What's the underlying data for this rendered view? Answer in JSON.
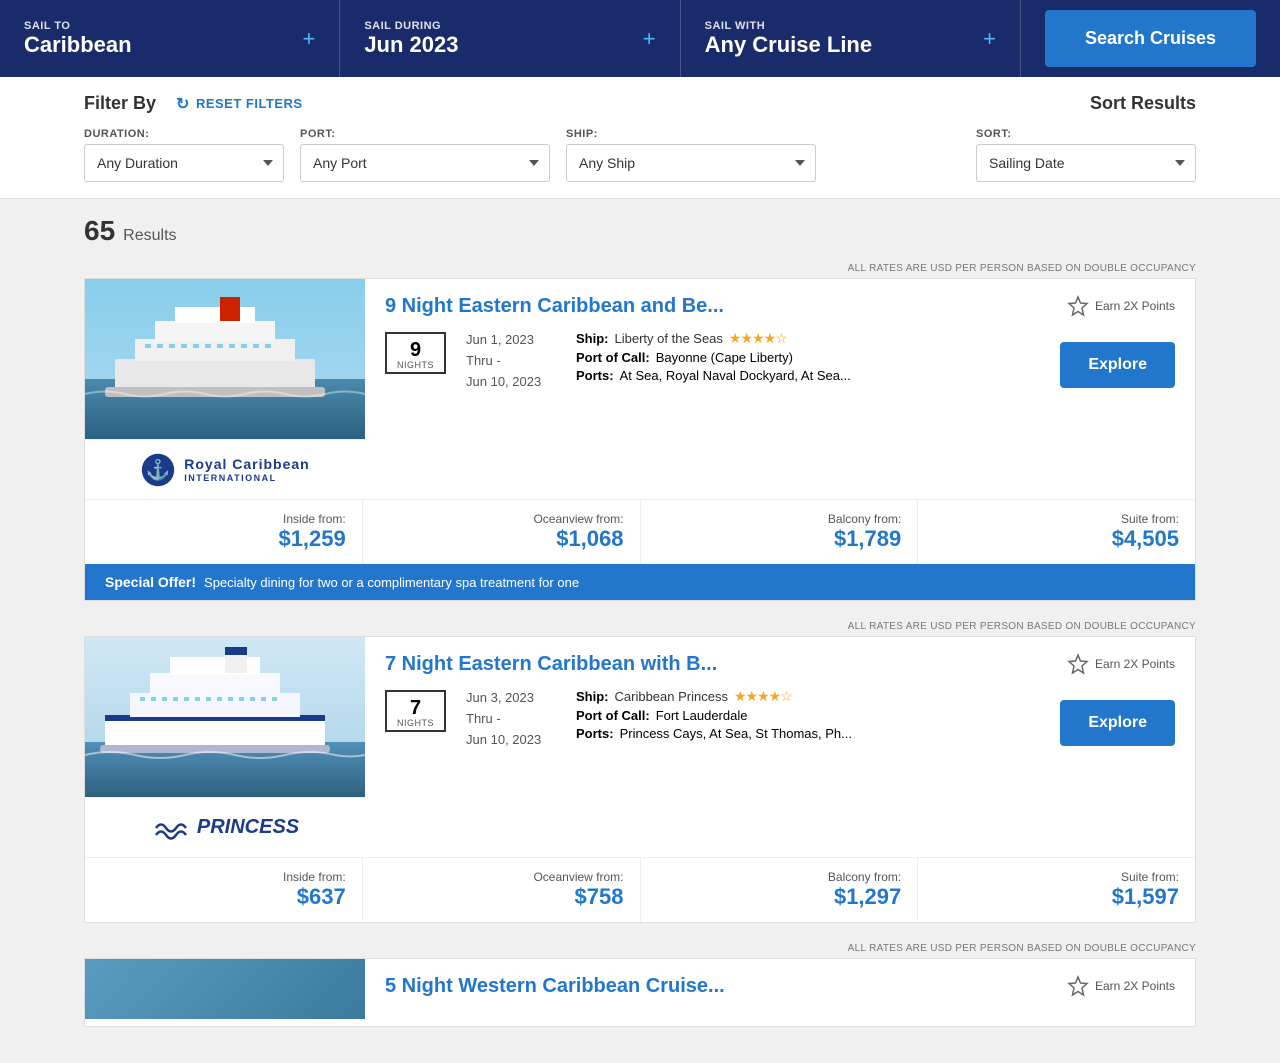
{
  "nav": {
    "sail_to_label": "SAIL TO",
    "sail_to_value": "Caribbean",
    "sail_during_label": "SAIL DURING",
    "sail_during_value": "Jun 2023",
    "sail_with_label": "SAIL WITH",
    "sail_with_value": "Any Cruise Line",
    "search_button": "Search Cruises"
  },
  "filter": {
    "filter_by": "Filter By",
    "reset_filters": "RESET FILTERS",
    "sort_results": "Sort Results",
    "duration_label": "DURATION:",
    "duration_value": "Any Duration",
    "port_label": "PORT:",
    "port_value": "Any Port",
    "ship_label": "SHIP:",
    "ship_value": "Any Ship",
    "sort_label": "SORT:",
    "sort_value": "Sailing Date"
  },
  "results": {
    "count": "65",
    "label": "Results",
    "rate_note": "ALL RATES ARE USD PER PERSON BASED ON DOUBLE OCCUPANCY"
  },
  "cruises": [
    {
      "id": 1,
      "title": "9 Night Eastern Caribbean and Be...",
      "nights": "9",
      "dates_start": "Jun 1, 2023",
      "dates_thru": "Thru -",
      "dates_end": "Jun 10, 2023",
      "ship_label": "Ship:",
      "ship_name": "Liberty of the Seas",
      "stars": "★★★★☆",
      "port_of_call_label": "Port of Call:",
      "port_of_call": "Bayonne (Cape Liberty)",
      "ports_label": "Ports:",
      "ports": "At Sea, Royal Naval Dockyard, At Sea...",
      "earn_points": "Earn 2X Points",
      "inside_from_label": "Inside from:",
      "inside_price": "$1,259",
      "oceanview_from_label": "Oceanview from:",
      "oceanview_price": "$1,068",
      "balcony_from_label": "Balcony from:",
      "balcony_price": "$1,789",
      "suite_from_label": "Suite from:",
      "suite_price": "$4,505",
      "explore_btn": "Explore",
      "cruise_line": "royal_caribbean",
      "special_offer": true,
      "special_offer_label": "Special Offer!",
      "special_offer_text": "Specialty dining for two or a complimentary spa treatment for one",
      "rate_note": "ALL RATES ARE USD PER PERSON BASED ON DOUBLE OCCUPANCY"
    },
    {
      "id": 2,
      "title": "7 Night Eastern Caribbean with B...",
      "nights": "7",
      "dates_start": "Jun 3, 2023",
      "dates_thru": "Thru -",
      "dates_end": "Jun 10, 2023",
      "ship_label": "Ship:",
      "ship_name": "Caribbean Princess",
      "stars": "★★★★☆",
      "port_of_call_label": "Port of Call:",
      "port_of_call": "Fort Lauderdale",
      "ports_label": "Ports:",
      "ports": "Princess Cays, At Sea, St Thomas, Ph...",
      "earn_points": "Earn 2X Points",
      "inside_from_label": "Inside from:",
      "inside_price": "$637",
      "oceanview_from_label": "Oceanview from:",
      "oceanview_price": "$758",
      "balcony_from_label": "Balcony from:",
      "balcony_price": "$1,297",
      "suite_from_label": "Suite from:",
      "suite_price": "$1,597",
      "explore_btn": "Explore",
      "cruise_line": "princess",
      "special_offer": false,
      "rate_note": "ALL RATES ARE USD PER PERSON BASED ON DOUBLE OCCUPANCY"
    },
    {
      "id": 3,
      "title": "5 Night Western Caribbean Cruise...",
      "nights": "5",
      "earn_points": "Earn 2X Points",
      "rate_note": "ALL RATES ARE USD PER PERSON BASED ON DOUBLE OCCUPANCY"
    }
  ]
}
